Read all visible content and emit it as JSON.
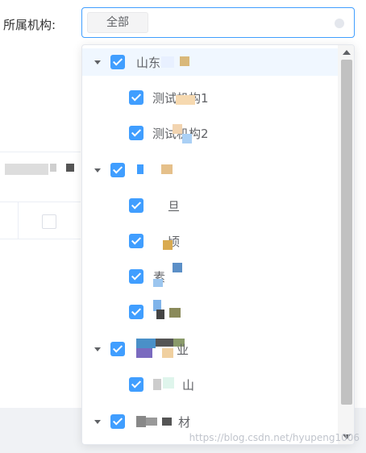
{
  "form": {
    "label": "所属机构:",
    "selected_tag": "全部"
  },
  "tree": {
    "nodes": [
      {
        "label": "山东",
        "level": 0,
        "expanded": true,
        "checked": true,
        "highlighted": true
      },
      {
        "label": "测试机构1",
        "level": 1,
        "checked": true
      },
      {
        "label": "测试机构2",
        "level": 1,
        "checked": true
      },
      {
        "label": "",
        "level": 0,
        "expanded": true,
        "checked": true
      },
      {
        "label": "旦",
        "level": 1,
        "checked": true
      },
      {
        "label": "顷",
        "level": 1,
        "checked": true
      },
      {
        "label": "素",
        "level": 1,
        "checked": true
      },
      {
        "label": "",
        "level": 1,
        "checked": true
      },
      {
        "label": "业",
        "level": 0,
        "expanded": true,
        "checked": true
      },
      {
        "label": "山",
        "level": 1,
        "checked": true
      },
      {
        "label": "材",
        "level": 0,
        "expanded": true,
        "checked": true
      }
    ]
  },
  "watermark": "https://blog.csdn.net/hyupeng1006",
  "colors": {
    "accent": "#409eff",
    "text": "#606266",
    "highlight": "#f0f7ff"
  }
}
